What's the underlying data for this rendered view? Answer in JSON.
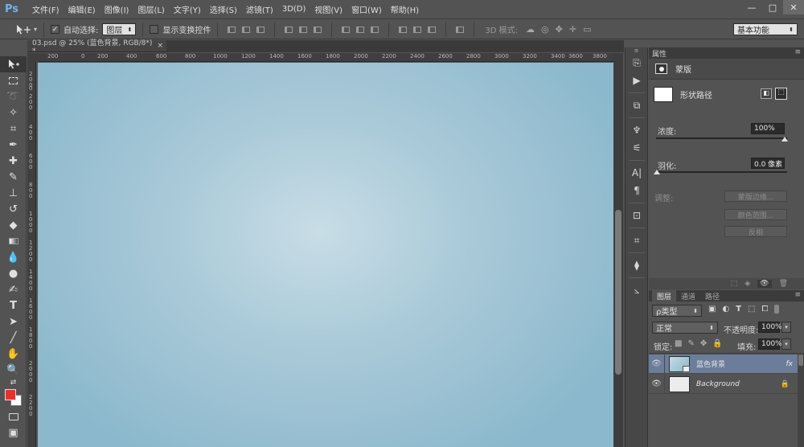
{
  "app": {
    "logo": "Ps"
  },
  "menu": [
    "文件(F)",
    "编辑(E)",
    "图像(I)",
    "图层(L)",
    "文字(Y)",
    "选择(S)",
    "滤镜(T)",
    "3D(D)",
    "视图(V)",
    "窗口(W)",
    "帮助(H)"
  ],
  "window_controls": {
    "minimize": "—",
    "maximize": "□",
    "close": "✕"
  },
  "options": {
    "auto_select_check": "✓",
    "auto_select_label": "自动选择:",
    "auto_select_value": "图层",
    "transform_label": "显示变换控件",
    "mode_3d_label": "3D 模式:",
    "workspace": "基本功能"
  },
  "document": {
    "tab_title": "03.psd @ 25% (蓝色背景, RGB/8*) *",
    "tab_close": "×"
  },
  "ruler_h": [
    "200",
    "0",
    "200",
    "400",
    "600",
    "800",
    "1000",
    "1200",
    "1400",
    "1600",
    "1800",
    "2000",
    "2200",
    "2400",
    "2600",
    "2800",
    "3000",
    "3200",
    "3400",
    "3600",
    "3800"
  ],
  "ruler_v": [
    "2 0 0",
    "0",
    "2 0 0",
    "4 0 0",
    "6 0 0",
    "8 0 0",
    "1 0 0 0",
    "1 2 0 0",
    "1 4 0 0",
    "1 6 0 0",
    "1 8 0 0",
    "2 0 0 0",
    "2 2 0 0"
  ],
  "properties": {
    "panel_title": "属性",
    "section_title": "蒙版",
    "shape_path_label": "形状路径",
    "density_label": "浓度:",
    "density_value": "100%",
    "feather_label": "羽化:",
    "feather_value": "0.0 像素",
    "adjust_label": "调整:",
    "mask_edge_btn": "蒙版边缘...",
    "color_range_btn": "颜色范围...",
    "invert_btn": "反相"
  },
  "layers": {
    "tabs": [
      "图层",
      "通道",
      "路径"
    ],
    "filter_kind": "ρ类型",
    "blend_mode": "正常",
    "opacity_label": "不透明度:",
    "opacity_value": "100%",
    "lock_label": "锁定:",
    "fill_label": "填充:",
    "fill_value": "100%",
    "items": [
      {
        "name": "蓝色背景",
        "fx": "fx"
      },
      {
        "name": "Background"
      }
    ]
  },
  "colors": {
    "foreground": "#e8312a",
    "background": "#ffffff"
  }
}
